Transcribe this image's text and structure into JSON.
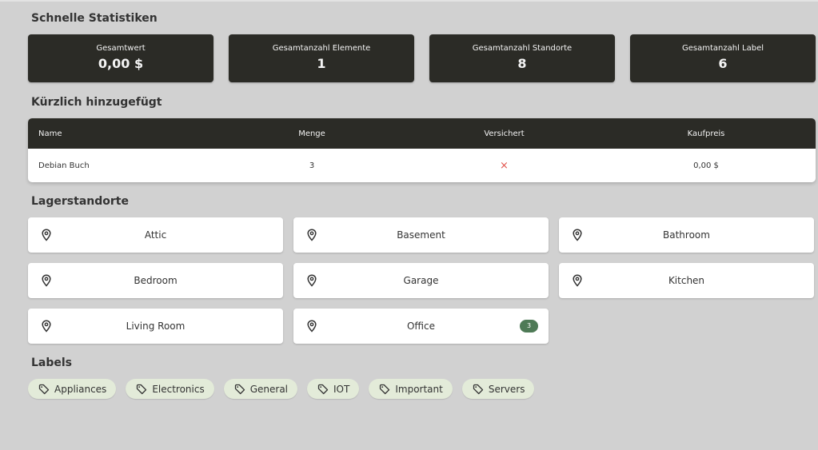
{
  "stats": {
    "title": "Schnelle Statistiken",
    "cards": [
      {
        "label": "Gesamtwert",
        "value": "0,00 $"
      },
      {
        "label": "Gesamtanzahl Elemente",
        "value": "1"
      },
      {
        "label": "Gesamtanzahl Standorte",
        "value": "8"
      },
      {
        "label": "Gesamtanzahl Label",
        "value": "6"
      }
    ]
  },
  "recent": {
    "title": "Kürzlich hinzugefügt",
    "columns": [
      "Name",
      "Menge",
      "Versichert",
      "Kaufpreis"
    ],
    "rows": [
      {
        "name": "Debian Buch",
        "quantity": "3",
        "insured_icon": "×",
        "price": "0,00 $"
      }
    ]
  },
  "locations": {
    "title": "Lagerstandorte",
    "icon": "map-pin-icon",
    "items": [
      {
        "name": "Attic"
      },
      {
        "name": "Basement"
      },
      {
        "name": "Bathroom"
      },
      {
        "name": "Bedroom"
      },
      {
        "name": "Garage"
      },
      {
        "name": "Kitchen"
      },
      {
        "name": "Living Room"
      },
      {
        "name": "Office",
        "badge": "3"
      }
    ]
  },
  "labels": {
    "title": "Labels",
    "icon": "tag-icon",
    "items": [
      "Appliances",
      "Electronics",
      "General",
      "IOT",
      "Important",
      "Servers"
    ]
  },
  "colors": {
    "background": "#d1d1d1",
    "card_dark": "#2b2b26",
    "chip_bg": "#e3ebd9",
    "badge": "#4e7a56",
    "not_insured": "#e2554e"
  }
}
